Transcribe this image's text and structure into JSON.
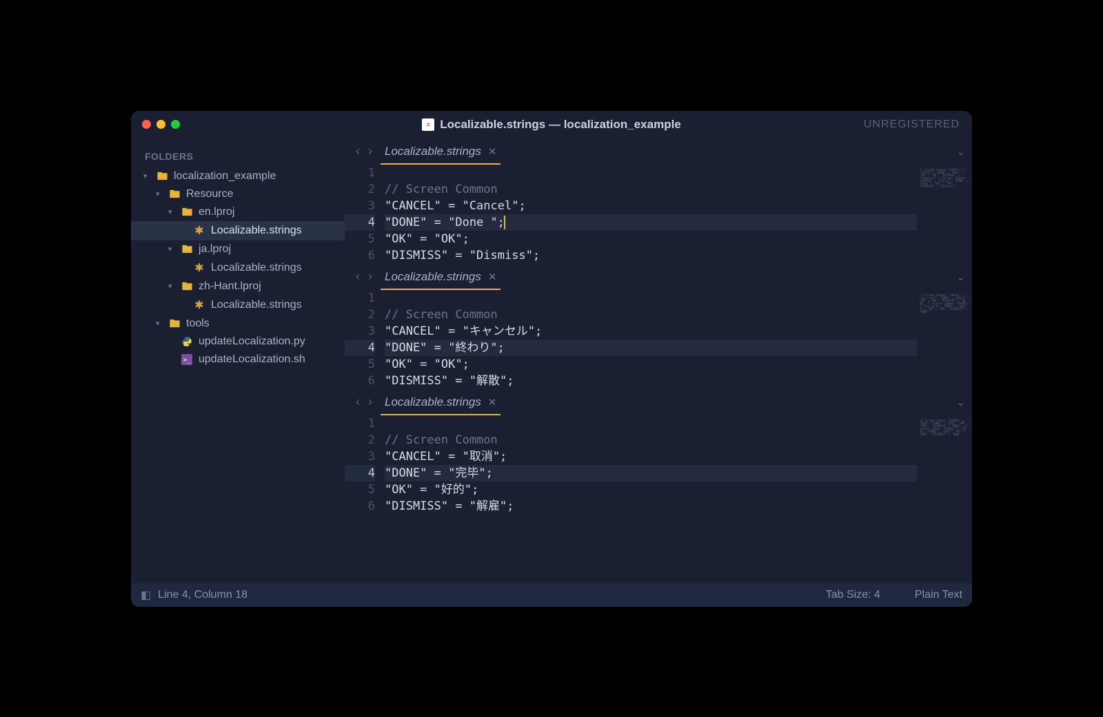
{
  "window": {
    "title": "Localizable.strings — localization_example",
    "registration_status": "UNREGISTERED"
  },
  "sidebar": {
    "header": "FOLDERS",
    "tree": [
      {
        "label": "localization_example",
        "type": "folder-open",
        "indent": 0,
        "expanded": true
      },
      {
        "label": "Resource",
        "type": "folder-open",
        "indent": 1,
        "expanded": true
      },
      {
        "label": "en.lproj",
        "type": "folder-open",
        "indent": 2,
        "expanded": true
      },
      {
        "label": "Localizable.strings",
        "type": "strings",
        "indent": 3,
        "selected": true
      },
      {
        "label": "ja.lproj",
        "type": "folder-open",
        "indent": 2,
        "expanded": true
      },
      {
        "label": "Localizable.strings",
        "type": "strings",
        "indent": 3
      },
      {
        "label": "zh-Hant.lproj",
        "type": "folder-open",
        "indent": 2,
        "expanded": true
      },
      {
        "label": "Localizable.strings",
        "type": "strings",
        "indent": 3
      },
      {
        "label": "tools",
        "type": "folder-open",
        "indent": 1,
        "expanded": true
      },
      {
        "label": "updateLocalization.py",
        "type": "python",
        "indent": 2
      },
      {
        "label": "updateLocalization.sh",
        "type": "shell",
        "indent": 2
      }
    ]
  },
  "panes": [
    {
      "tab_label": "Localizable.strings",
      "lines": [
        {
          "n": 1,
          "t": ""
        },
        {
          "n": 2,
          "t": "// Screen Common",
          "comment": true
        },
        {
          "n": 3,
          "t": "\"CANCEL\" = \"Cancel\";"
        },
        {
          "n": 4,
          "t": "\"DONE\" = \"Done \";",
          "hl": true,
          "cursor": true
        },
        {
          "n": 5,
          "t": "\"OK\" = \"OK\";"
        },
        {
          "n": 6,
          "t": "\"DISMISS\" = \"Dismiss\";"
        }
      ]
    },
    {
      "tab_label": "Localizable.strings",
      "lines": [
        {
          "n": 1,
          "t": ""
        },
        {
          "n": 2,
          "t": "// Screen Common",
          "comment": true
        },
        {
          "n": 3,
          "t": "\"CANCEL\" = \"キャンセル\";"
        },
        {
          "n": 4,
          "t": "\"DONE\" = \"終わり\";",
          "hl": true
        },
        {
          "n": 5,
          "t": "\"OK\" = \"OK\";"
        },
        {
          "n": 6,
          "t": "\"DISMISS\" = \"解散\";"
        }
      ]
    },
    {
      "tab_label": "Localizable.strings",
      "lines": [
        {
          "n": 1,
          "t": ""
        },
        {
          "n": 2,
          "t": "// Screen Common",
          "comment": true
        },
        {
          "n": 3,
          "t": "\"CANCEL\" = \"取消\";"
        },
        {
          "n": 4,
          "t": "\"DONE\" = \"完毕\";",
          "hl": true
        },
        {
          "n": 5,
          "t": "\"OK\" = \"好的\";"
        },
        {
          "n": 6,
          "t": "\"DISMISS\" = \"解雇\";"
        }
      ]
    }
  ],
  "status": {
    "cursor": "Line 4, Column 18",
    "tab_size": "Tab Size: 4",
    "syntax": "Plain Text"
  },
  "icons": {
    "chev_down": "▾",
    "chev_left": "‹",
    "chev_right": "›",
    "close": "✕",
    "dropdown": "⌄",
    "panel": "◧"
  }
}
